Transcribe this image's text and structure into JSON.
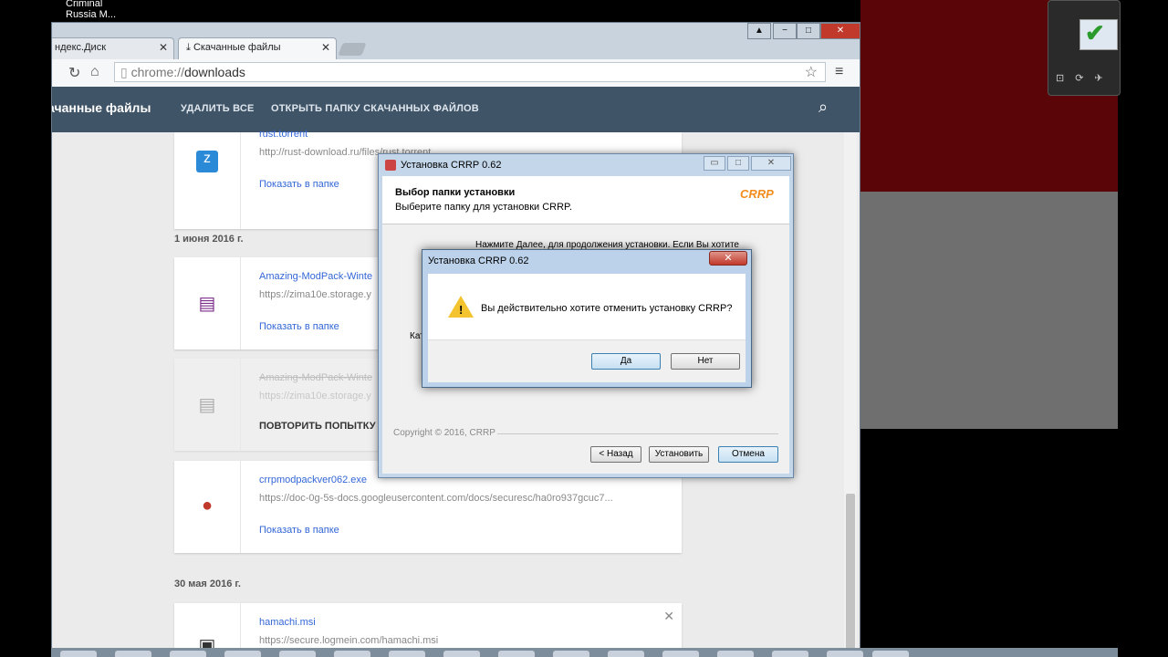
{
  "desktop": {
    "icon_label_line1": "Criminal",
    "icon_label_line2": "Russia M..."
  },
  "browser": {
    "tabs": [
      {
        "label": "ндекс.Диск"
      },
      {
        "label": "Скачанные файлы"
      }
    ],
    "address": {
      "scheme": "chrome://",
      "path": "downloads"
    },
    "window_buttons": [
      "−",
      "□",
      "✕"
    ]
  },
  "downloads_page": {
    "title": "качанные файлы",
    "actions": {
      "clear_all": "УДАЛИТЬ ВСЕ",
      "open_folder": "ОТКРЫТЬ ПАПКУ СКАЧАННЫХ ФАЙЛОВ"
    },
    "show_in_folder": "Показать в папке",
    "retry": "ПОВТОРИТЬ ПОПЫТКУ",
    "items": [
      {
        "name": "rust.torrent",
        "url": "http://rust-download.ru/files/rust.torrent"
      },
      {
        "date": "1 июня 2016 г."
      },
      {
        "name": "Amazing-ModPack-Winte",
        "url": "https://zima10e.storage.y"
      },
      {
        "name": "Amazing-ModPack-Winte",
        "url": "https://zima10e.storage.y"
      },
      {
        "name": "crrpmodpackver062.exe",
        "url": "https://doc-0g-5s-docs.googleusercontent.com/docs/securesc/ha0ro937gcuc7..."
      },
      {
        "date": "30 мая 2016 г."
      },
      {
        "name": "hamachi.msi",
        "url": "https://secure.logmein.com/hamachi.msi"
      }
    ]
  },
  "installer": {
    "title": "Установка CRRP 0.62",
    "heading": "Выбор папки установки",
    "subheading": "Выберите папку для установки CRRP.",
    "logo_text": "CRRP",
    "body_text": "Нажмите Далее, для продолжения установки. Если Вы хотите",
    "cat_label": "Кат",
    "copyright": "Copyright © 2016, CRRP",
    "buttons": {
      "back": "< Назад",
      "install": "Установить",
      "cancel": "Отмена"
    }
  },
  "confirm_dialog": {
    "title": "Установка CRRP 0.62",
    "message": "Вы действительно хотите отменить установку CRRP?",
    "buttons": {
      "yes": "Да",
      "no": "Нет"
    }
  },
  "colors": {
    "appbar": "#3f5467",
    "link": "#3367d6",
    "desktop_red": "#5a0508"
  }
}
